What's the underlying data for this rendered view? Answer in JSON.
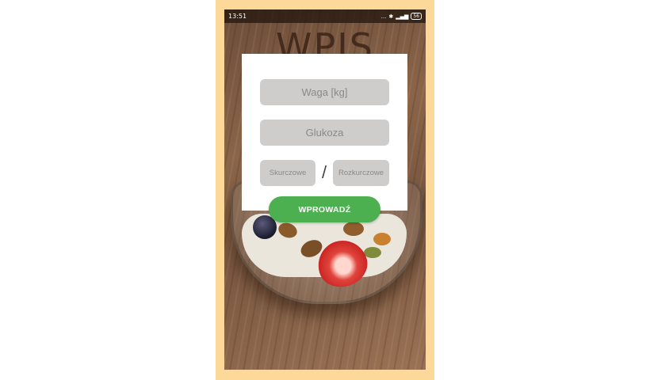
{
  "status_bar": {
    "time": "13:51",
    "signal_text": "...",
    "network_text": "⁴ᴳ",
    "battery": "56"
  },
  "app": {
    "title": "WPIS"
  },
  "form": {
    "weight_placeholder": "Waga [kg]",
    "glucose_placeholder": "Glukoza",
    "systolic_placeholder": "Skurczowe",
    "diastolic_placeholder": "Rozkurczowe",
    "separator": "/",
    "submit_label": "WPROWADŹ"
  },
  "colors": {
    "frame": "#fcd999",
    "submit": "#4caf50",
    "field": "#cfcdcb"
  }
}
